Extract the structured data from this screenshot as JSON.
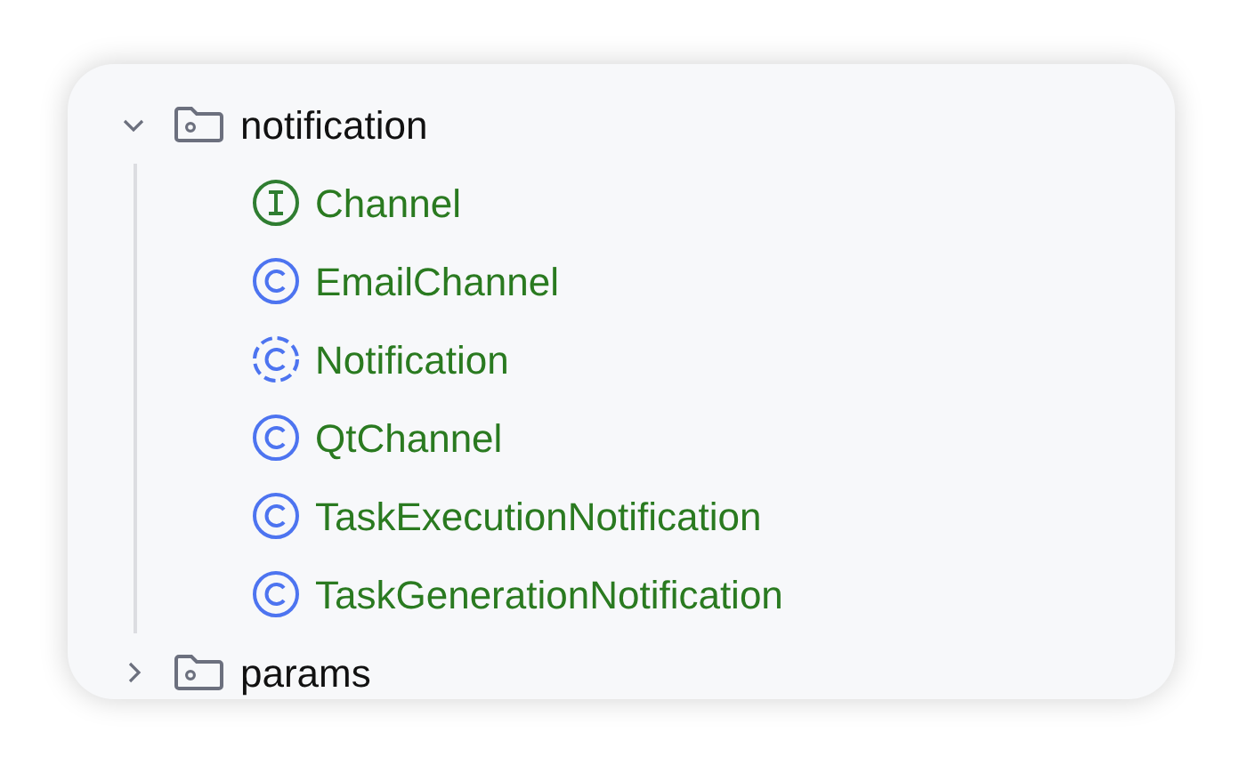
{
  "tree": [
    {
      "label": "notification",
      "kind": "folder",
      "expanded": true,
      "children": [
        {
          "label": "Channel",
          "kind": "interface"
        },
        {
          "label": "EmailChannel",
          "kind": "class"
        },
        {
          "label": "Notification",
          "kind": "abstract"
        },
        {
          "label": "QtChannel",
          "kind": "class"
        },
        {
          "label": "TaskExecutionNotification",
          "kind": "class"
        },
        {
          "label": "TaskGenerationNotification",
          "kind": "class"
        }
      ]
    },
    {
      "label": "params",
      "kind": "folder",
      "expanded": false
    }
  ]
}
